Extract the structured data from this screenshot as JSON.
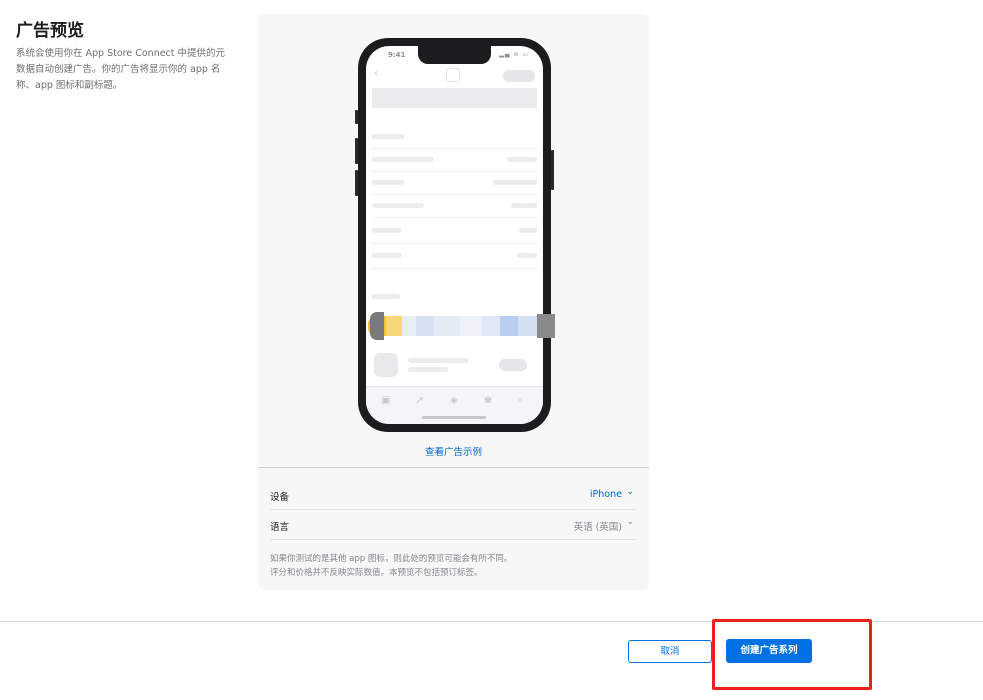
{
  "section": {
    "title": "广告预览",
    "description": "系统会使用你在 App Store Connect 中提供的元数据自动创建广告。你的广告将显示你的 app 名称、app 图标和副标题。"
  },
  "phone": {
    "status_time": "9:41",
    "status_icons": "▂▄ ≋ ▭",
    "back_glyph": "‹",
    "tab_icons": [
      "photo-icon",
      "rocket-icon",
      "layers-icon",
      "arcade-icon",
      "search-icon"
    ],
    "tab_glyphs": [
      "▣",
      "➚",
      "◈",
      "♚",
      "⌕"
    ]
  },
  "preview": {
    "view_example_link": "查看广告示例"
  },
  "settings": {
    "device_label": "设备",
    "device_value": "iPhone",
    "language_label": "语言",
    "language_value": "英语 (英国)",
    "chevron": "⌄"
  },
  "disclaimer": {
    "line1": "如果你测试的是其他 app 图标，则此处的预览可能会有所不同。",
    "line2": "评分和价格并不反映实际数值。本预览不包括预订标签。"
  },
  "footer": {
    "cancel_label": "取消",
    "create_label": "创建广告系列"
  },
  "colors": {
    "accent": "#0071e3",
    "link": "#0066cc",
    "highlight": "#e8211d"
  }
}
